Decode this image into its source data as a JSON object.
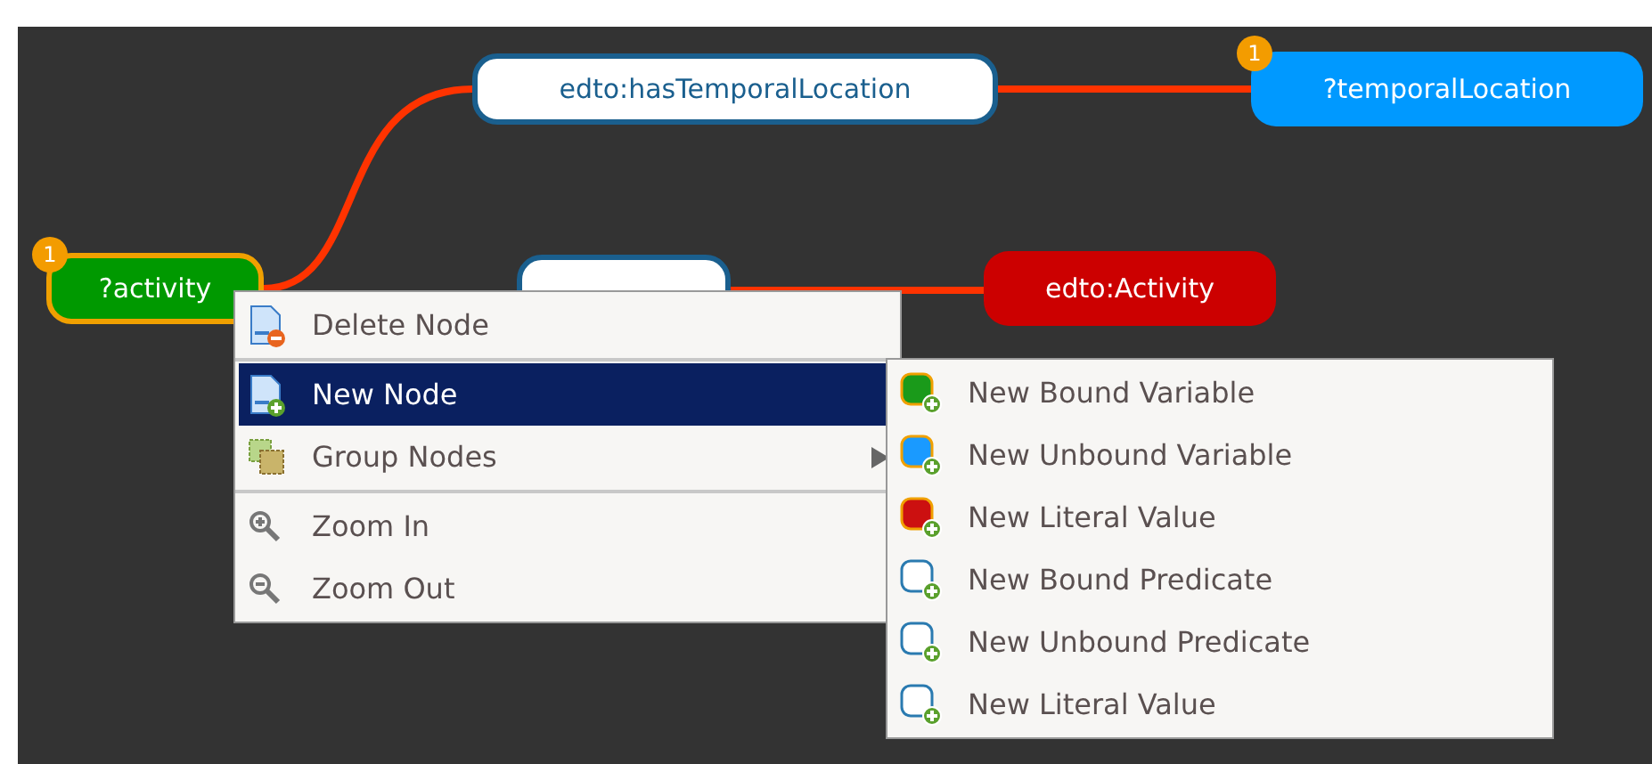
{
  "nodes": [
    {
      "kind": "variable",
      "label": "?activity",
      "color": "#009900",
      "badge": "1",
      "selected": true
    },
    {
      "kind": "predicate",
      "label": "edto:hasTemporalLocation",
      "selected": false
    },
    {
      "kind": "variable",
      "label": "?temporalLocation",
      "color": "#0099ff",
      "badge": "1",
      "selected": false
    },
    {
      "kind": "predicate",
      "selected": false
    },
    {
      "kind": "literal",
      "label": "edto:Activity",
      "color": "#cc0000",
      "selected": false
    }
  ],
  "context_menu": {
    "items": [
      {
        "kind": "item",
        "label": "Delete Node",
        "selected": false,
        "submenu": false
      },
      {
        "kind": "separator"
      },
      {
        "kind": "item",
        "label": "New Node",
        "selected": true,
        "submenu": false
      },
      {
        "kind": "item",
        "label": "Group Nodes",
        "selected": false,
        "submenu": true
      },
      {
        "kind": "separator"
      },
      {
        "kind": "item",
        "label": "Zoom In",
        "selected": false,
        "submenu": false
      },
      {
        "kind": "item",
        "label": "Zoom Out",
        "selected": false,
        "submenu": false
      }
    ]
  },
  "submenu": {
    "items": [
      {
        "kind": "variable",
        "label": "New Bound Variable",
        "color": "#1a9a1a"
      },
      {
        "kind": "variable",
        "label": "New Unbound Variable",
        "color": "#1a9aff"
      },
      {
        "kind": "variable",
        "label": "New Literal Value",
        "color": "#cc1010"
      },
      {
        "kind": "predicate",
        "label": "New Bound Predicate"
      },
      {
        "kind": "predicate",
        "label": "New Unbound Predicate"
      },
      {
        "kind": "predicate",
        "label": "New Literal Value"
      }
    ]
  }
}
